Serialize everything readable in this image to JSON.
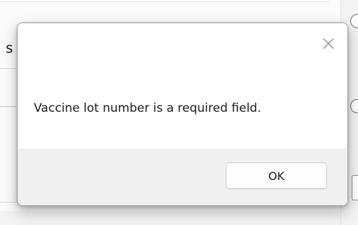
{
  "dialog": {
    "message": "Vaccine lot number is a required field.",
    "ok_label": "OK",
    "close_icon": "close-icon"
  },
  "background": {
    "partial_text": "s"
  },
  "colors": {
    "dialog_background": "#ffffff",
    "footer_background": "#f0f0f0",
    "page_background": "#f3f3f3"
  }
}
